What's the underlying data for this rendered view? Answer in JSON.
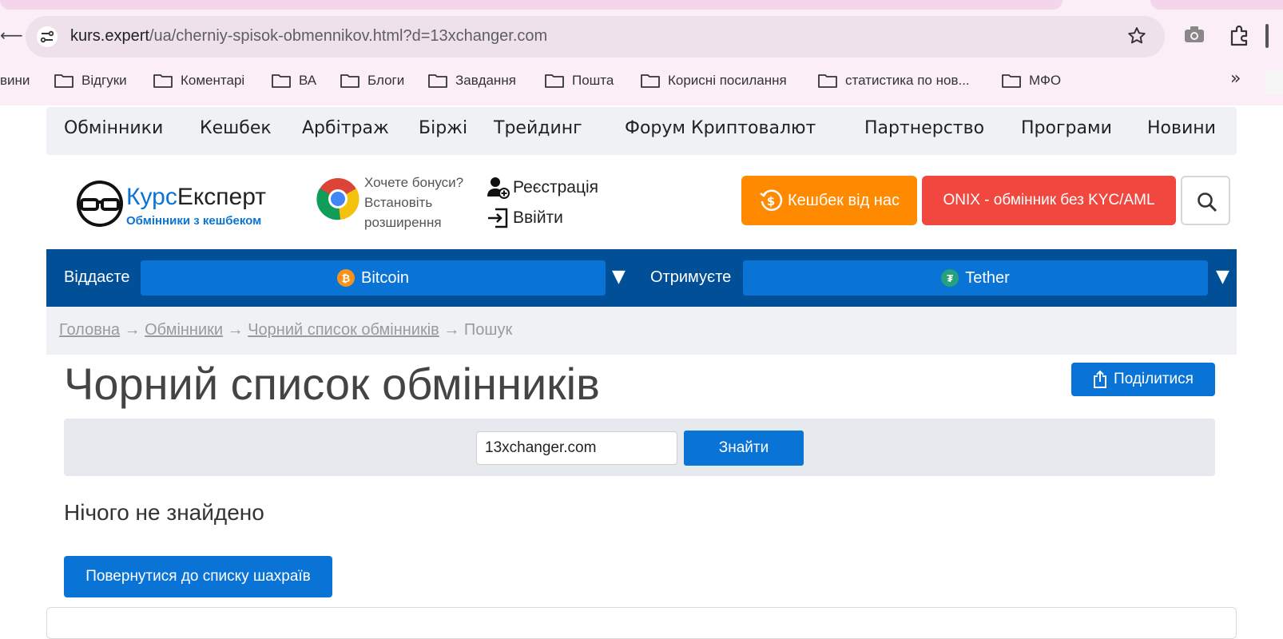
{
  "browser": {
    "url_host": "kurs.expert",
    "url_path": "/ua/cherniy-spisok-obmennikov.html?d=13xchanger.com",
    "bookmarks": [
      {
        "label": "вини"
      },
      {
        "label": "Відгуки"
      },
      {
        "label": "Коментарі"
      },
      {
        "label": "ВА"
      },
      {
        "label": "Блоги"
      },
      {
        "label": "Завдання"
      },
      {
        "label": "Пошта"
      },
      {
        "label": "Корисні посилання"
      },
      {
        "label": "статистика по нов..."
      },
      {
        "label": "МФО"
      }
    ],
    "more_bookmarks": "»"
  },
  "nav": {
    "items": [
      "Обмінники",
      "Кешбек",
      "Арбітраж",
      "Біржі",
      "Трейдинг",
      "Форум Криптовалют",
      "Партнерство",
      "Програми",
      "Новини"
    ]
  },
  "header": {
    "logo_part1": "Курс",
    "logo_part2": "Експерт",
    "logo_tagline": "Обмінники з кешбеком",
    "ext_line1": "Хочете бонуси?",
    "ext_line2": "Встановіть",
    "ext_line3": "розширення",
    "register": "Реєстрація",
    "login": "Ввійти",
    "cashback_btn": "Кешбек від нас",
    "onix_btn": "ONIX - обмінник без KYC/AML"
  },
  "exchange": {
    "give_label": "Віддаєте",
    "give_currency": "Bitcoin",
    "get_label": "Отримуєте",
    "get_currency": "Tether",
    "dropdown_arrow": "▼",
    "colors": {
      "bitcoin": "#f7931a",
      "tether": "#26a17b"
    }
  },
  "breadcrumb": {
    "home": "Головна",
    "exchangers": "Обмінники",
    "blacklist": "Чорний список обмінників",
    "search": "Пошук",
    "sep": "→"
  },
  "page": {
    "title": "Чорний список обмінників",
    "share_btn": "Поділитися",
    "search_value": "13xchanger.com",
    "find_btn": "Знайти",
    "nothing_found": "Нічого не знайдено",
    "back_btn": "Повернутися до списку шахраїв"
  },
  "colors": {
    "brand_blue": "#0a74d6",
    "nav_dark": "#004f97",
    "orange": "#ff8a00",
    "red": "#f0483e"
  }
}
